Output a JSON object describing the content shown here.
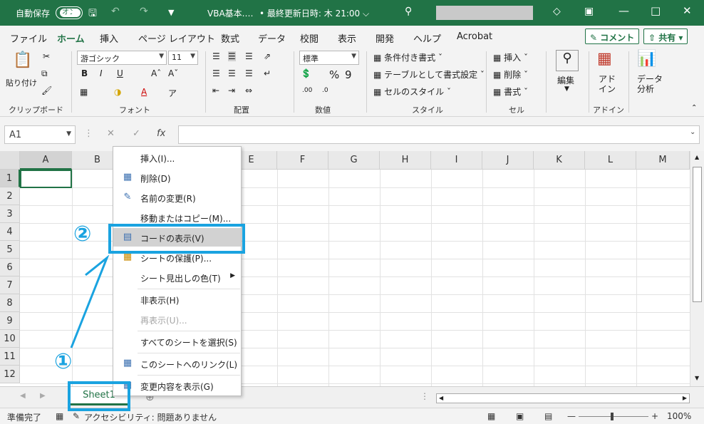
{
  "titlebar": {
    "autosave_label": "自動保存",
    "autosave_toggle": "オン",
    "doc_title": "VBA基本.…",
    "last_modified": "• 最終更新日時: 木 21:00 ⌵"
  },
  "tabs": [
    "ファイル",
    "ホーム",
    "挿入",
    "ページ レイアウト",
    "数式",
    "データ",
    "校閲",
    "表示",
    "開発",
    "ヘルプ",
    "Acrobat"
  ],
  "tab_buttons": {
    "comment": "コメント",
    "share": "共有"
  },
  "ribbon": {
    "clipboard": {
      "paste": "貼り付け",
      "label": "クリップボード"
    },
    "font": {
      "name": "游ゴシック",
      "size": "11",
      "label": "フォント"
    },
    "alignment": {
      "label": "配置"
    },
    "number": {
      "format": "標準",
      "label": "数値"
    },
    "styles": {
      "conditional": "条件付き書式",
      "table": "テーブルとして書式設定",
      "cell": "セルのスタイル",
      "label": "スタイル"
    },
    "cells": {
      "insert": "挿入",
      "delete": "削除",
      "format": "書式",
      "label": "セル"
    },
    "editing": {
      "label": "編集"
    },
    "addins": {
      "name": "アド\nイン",
      "label": "アドイン"
    },
    "analysis": {
      "name": "データ\n分析"
    }
  },
  "formula_bar": {
    "name_box": "A1"
  },
  "grid": {
    "columns": [
      "A",
      "B",
      "C",
      "D",
      "E",
      "F",
      "G",
      "H",
      "I",
      "J",
      "K",
      "L",
      "M"
    ],
    "rows": [
      "1",
      "2",
      "3",
      "4",
      "5",
      "6",
      "7",
      "8",
      "9",
      "10",
      "11",
      "12"
    ]
  },
  "context_menu": [
    {
      "label": "挿入(I)...",
      "icon": ""
    },
    {
      "label": "削除(D)",
      "icon": "delete-icon"
    },
    {
      "label": "名前の変更(R)",
      "icon": "rename-icon"
    },
    {
      "label": "移動またはコピー(M)...",
      "icon": ""
    },
    {
      "label": "コードの表示(V)",
      "icon": "view-code-icon",
      "highlighted": true
    },
    {
      "label": "シートの保護(P)...",
      "icon": "protect-icon"
    },
    {
      "label": "シート見出しの色(T)",
      "icon": "",
      "submenu": true
    },
    {
      "label": "非表示(H)",
      "icon": ""
    },
    {
      "label": "再表示(U)...",
      "icon": "",
      "disabled": true
    },
    {
      "label": "すべてのシートを選択(S)",
      "icon": ""
    },
    {
      "label": "このシートへのリンク(L)",
      "icon": "link-icon"
    },
    {
      "label": "変更内容を表示(G)",
      "icon": "changes-icon"
    }
  ],
  "sheet_tab": "Sheet1",
  "status": {
    "ready": "準備完了",
    "accessibility": "アクセシビリティ: 問題ありません",
    "zoom": "100%"
  },
  "annotations": {
    "one": "①",
    "two": "②"
  },
  "colors": {
    "excel_green": "#217346",
    "annotation_blue": "#1aa3e0"
  }
}
